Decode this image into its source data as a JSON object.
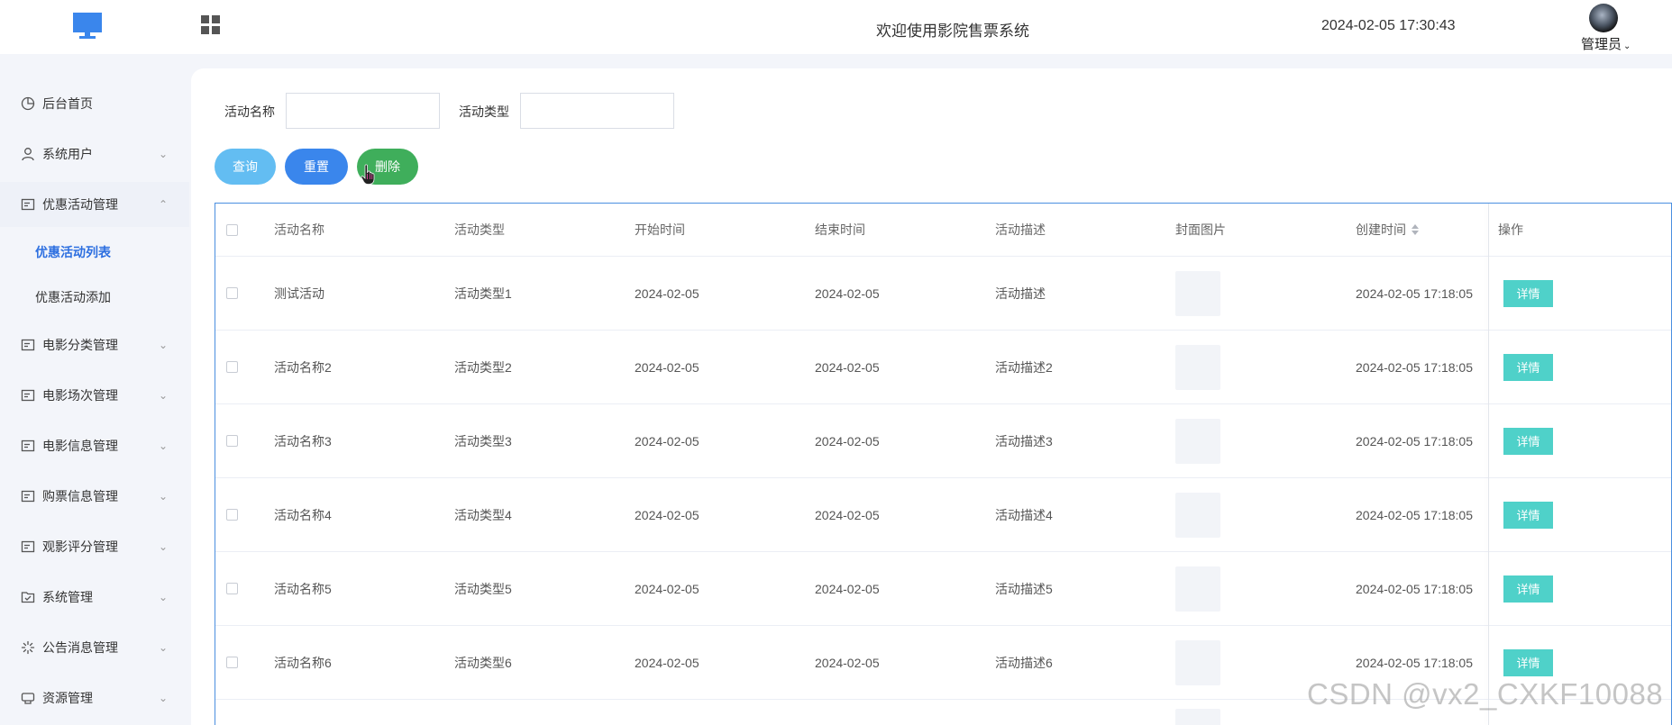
{
  "header": {
    "title": "欢迎使用影院售票系统",
    "datetime": "2024-02-05 17:30:43",
    "user": "管理员"
  },
  "sidebar": {
    "items": [
      {
        "label": "后台首页",
        "icon": "pie-chart-icon"
      },
      {
        "label": "系统用户",
        "icon": "user-icon"
      },
      {
        "label": "优惠活动管理",
        "icon": "card-icon",
        "open": true,
        "children": [
          {
            "label": "优惠活动列表",
            "active": true
          },
          {
            "label": "优惠活动添加"
          }
        ]
      },
      {
        "label": "电影分类管理",
        "icon": "card-icon"
      },
      {
        "label": "电影场次管理",
        "icon": "card-icon"
      },
      {
        "label": "电影信息管理",
        "icon": "card-icon"
      },
      {
        "label": "购票信息管理",
        "icon": "card-icon"
      },
      {
        "label": "观影评分管理",
        "icon": "card-icon"
      },
      {
        "label": "系统管理",
        "icon": "folder-check-icon"
      },
      {
        "label": "公告消息管理",
        "icon": "loading-icon"
      },
      {
        "label": "资源管理",
        "icon": "cloud-icon"
      }
    ]
  },
  "search": {
    "name_label": "活动名称",
    "name_value": "",
    "type_label": "活动类型",
    "type_value": "",
    "query_label": "查询",
    "reset_label": "重置",
    "delete_label": "删除"
  },
  "table": {
    "columns": [
      "活动名称",
      "活动类型",
      "开始时间",
      "结束时间",
      "活动描述",
      "封面图片",
      "创建时间",
      "操作"
    ],
    "detail_label": "详情",
    "rows": [
      [
        "测试活动",
        "活动类型1",
        "2024-02-05",
        "2024-02-05",
        "活动描述",
        "",
        "2024-02-05 17:18:05"
      ],
      [
        "活动名称2",
        "活动类型2",
        "2024-02-05",
        "2024-02-05",
        "活动描述2",
        "",
        "2024-02-05 17:18:05"
      ],
      [
        "活动名称3",
        "活动类型3",
        "2024-02-05",
        "2024-02-05",
        "活动描述3",
        "",
        "2024-02-05 17:18:05"
      ],
      [
        "活动名称4",
        "活动类型4",
        "2024-02-05",
        "2024-02-05",
        "活动描述4",
        "",
        "2024-02-05 17:18:05"
      ],
      [
        "活动名称5",
        "活动类型5",
        "2024-02-05",
        "2024-02-05",
        "活动描述5",
        "",
        "2024-02-05 17:18:05"
      ],
      [
        "活动名称6",
        "活动类型6",
        "2024-02-05",
        "2024-02-05",
        "活动描述6",
        "",
        "2024-02-05 17:18:05"
      ]
    ]
  },
  "watermark": "CSDN @vx2_CXKF10088",
  "colors": {
    "query": "#63bdf2",
    "reset": "#3a86ec",
    "delete": "#3fae5b",
    "detail": "#4fd1c9",
    "active_menu": "#2d6fe0"
  }
}
